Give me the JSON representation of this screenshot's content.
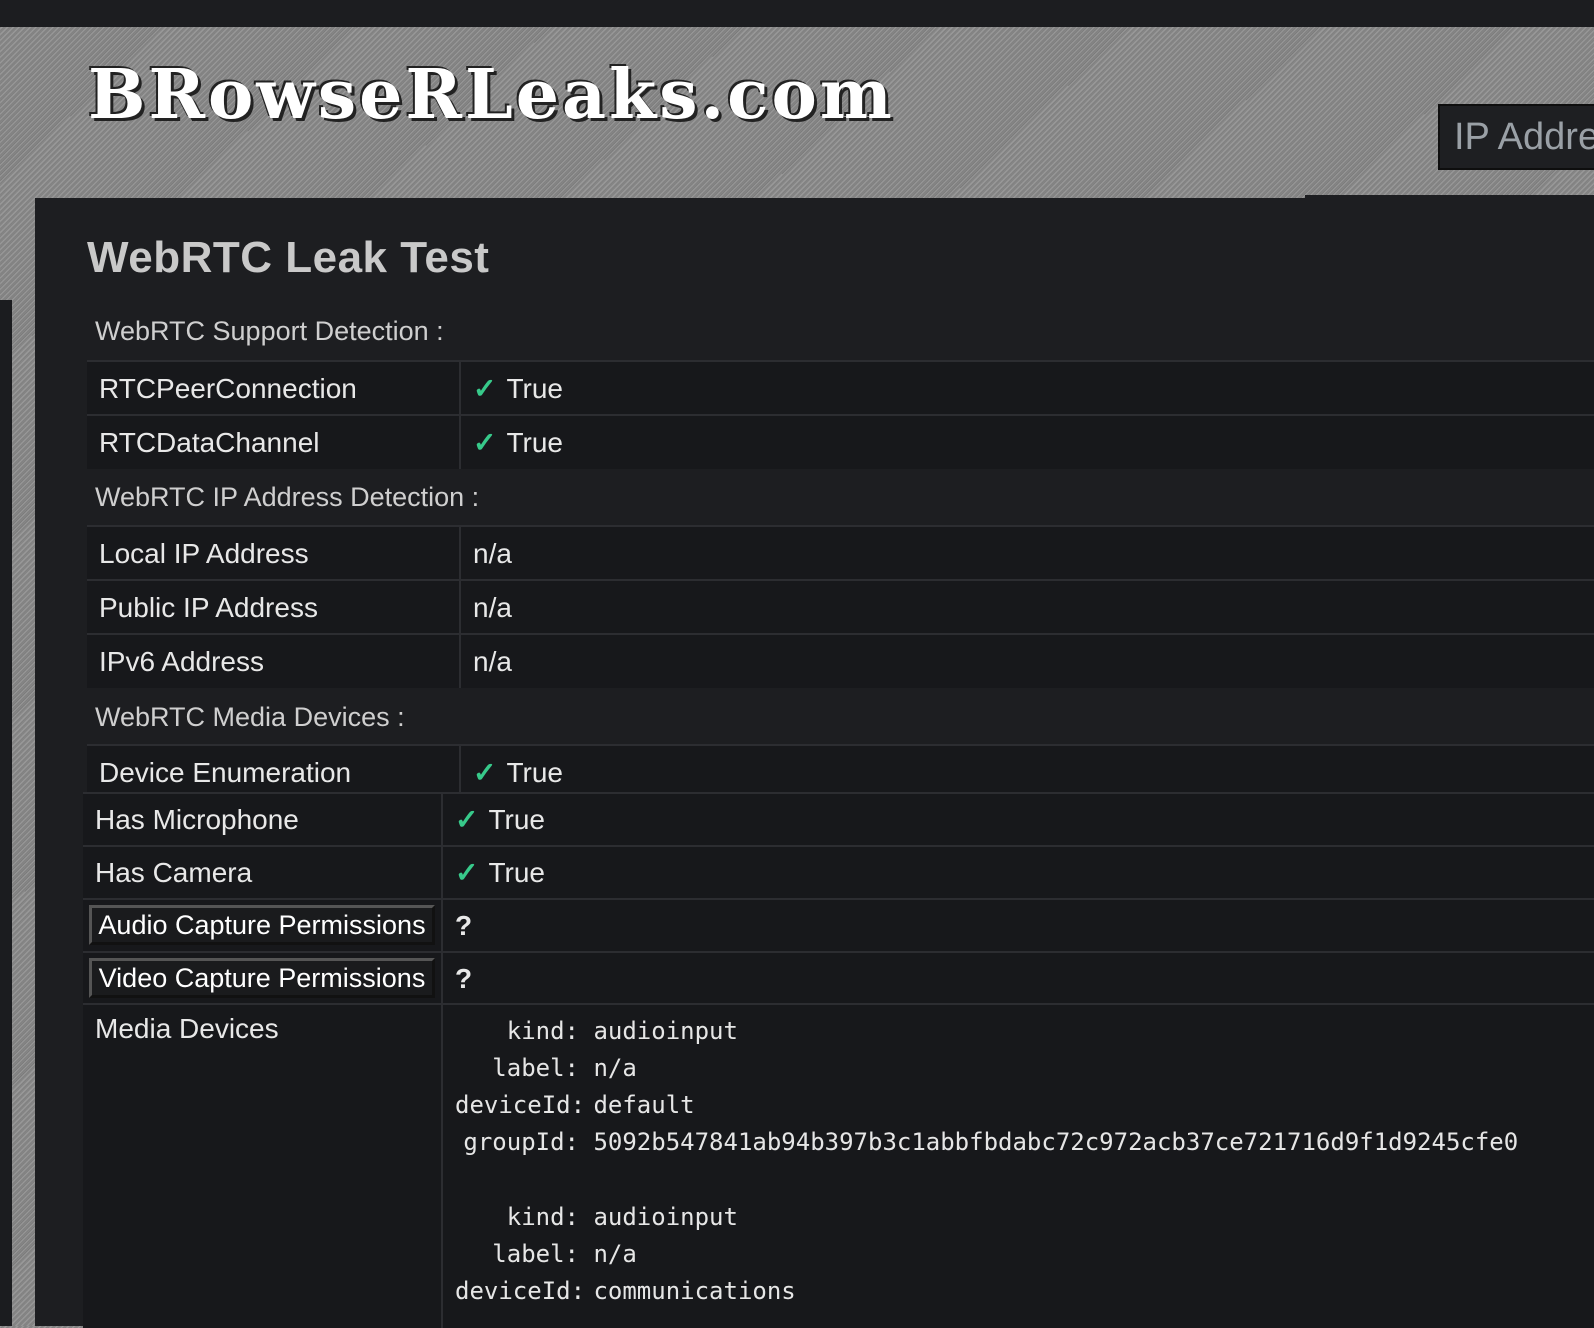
{
  "header": {
    "logo_text": "BRowseRLeaks.com",
    "ip_tab_label": "IP Addre"
  },
  "page_title": "WebRTC Leak Test",
  "sections": {
    "support": {
      "label": "WebRTC Support Detection :",
      "rows": [
        {
          "key": "RTCPeerConnection",
          "value": "True"
        },
        {
          "key": "RTCDataChannel",
          "value": "True"
        }
      ]
    },
    "ip": {
      "label": "WebRTC IP Address Detection :",
      "rows": [
        {
          "key": "Local IP Address",
          "value": "n/a"
        },
        {
          "key": "Public IP Address",
          "value": "n/a"
        },
        {
          "key": "IPv6 Address",
          "value": "n/a"
        }
      ]
    },
    "media": {
      "label": "WebRTC Media Devices :",
      "rows": [
        {
          "key": "Device Enumeration",
          "value": "True"
        },
        {
          "key": "Has Microphone",
          "value": "True"
        },
        {
          "key": "Has Camera",
          "value": "True"
        }
      ],
      "audio_button": "Audio Capture Permissions",
      "audio_status": "?",
      "video_button": "Video Capture Permissions",
      "video_status": "?",
      "devices_label": "Media Devices",
      "devices": [
        {
          "kind": "audioinput",
          "label": "n/a",
          "deviceId": "default",
          "groupId": "5092b547841ab94b397b3c1abbfbdabc72c972acb37ce721716d9f1d9245cfe0"
        },
        {
          "kind": "audioinput",
          "label": "n/a",
          "deviceId": "communications"
        }
      ],
      "field_labels": {
        "kind": "kind:",
        "label": "label:",
        "deviceId": "deviceId:",
        "groupId": "groupId:"
      }
    }
  },
  "check_glyph": "✓",
  "icons": [
    "check-icon",
    "question-icon"
  ],
  "colors": {
    "check": "#37c98a",
    "question": "#ff5252",
    "panel": "#1d1e21"
  }
}
